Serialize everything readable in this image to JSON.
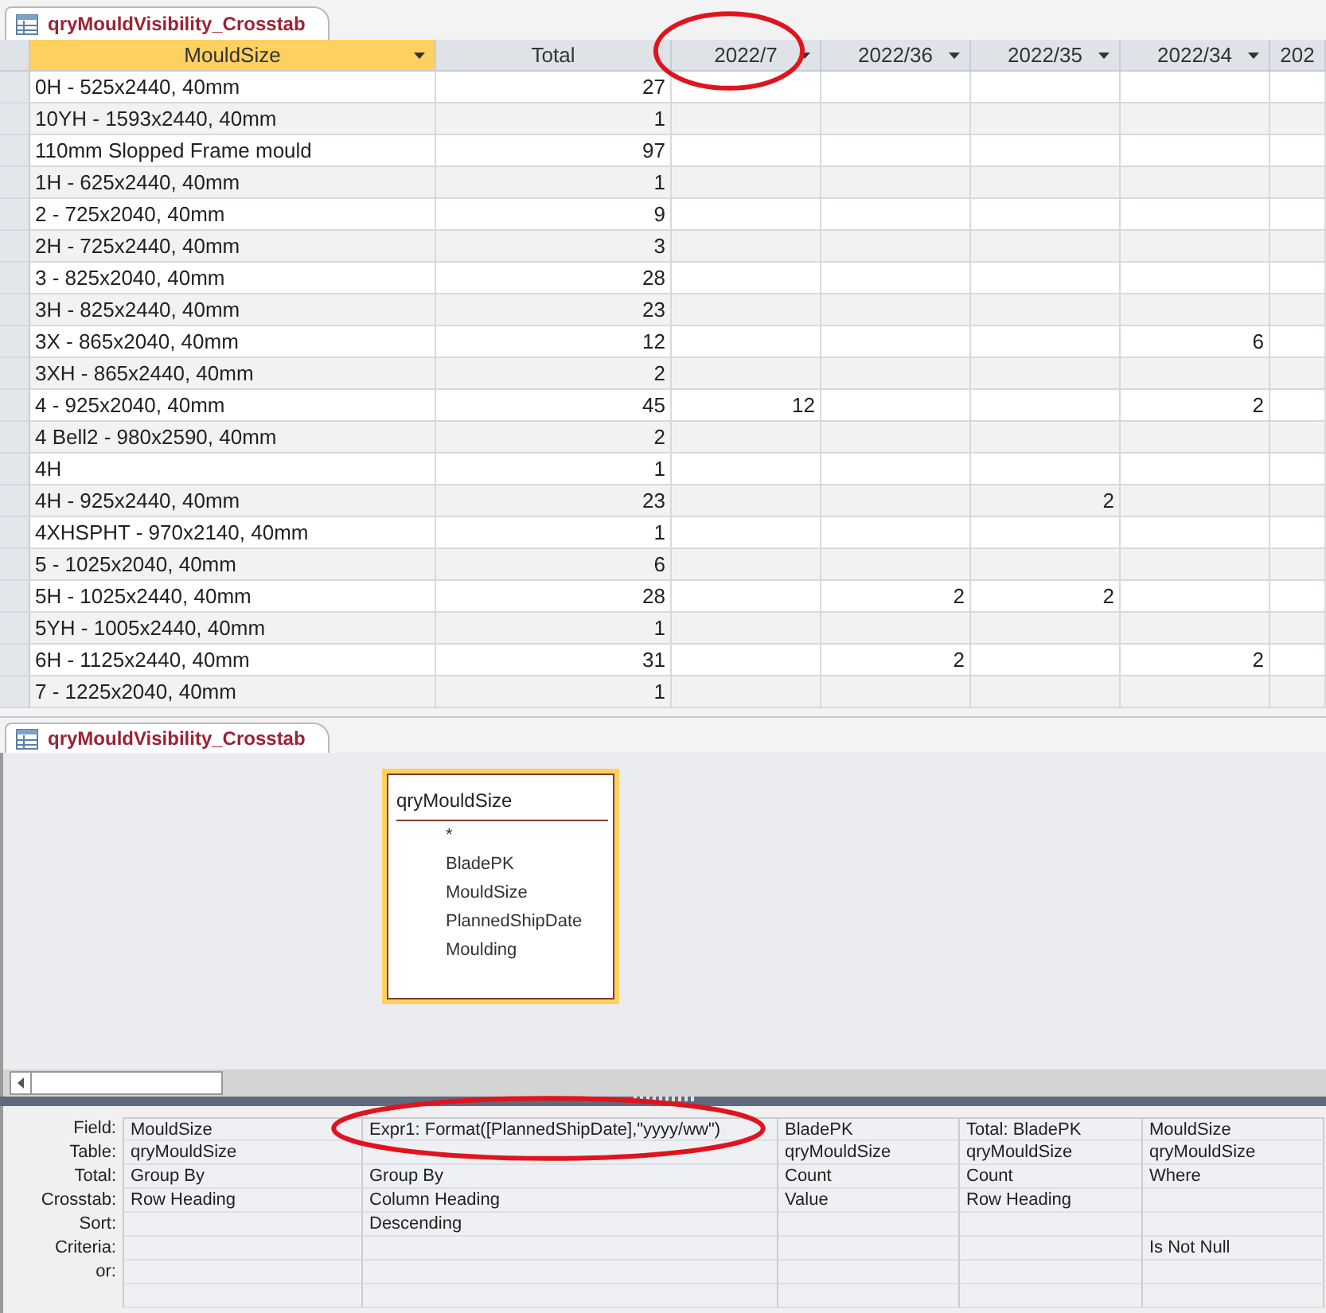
{
  "datasheet": {
    "tab": {
      "title": "qryMouldVisibility_Crosstab"
    },
    "columns": [
      {
        "label": "MouldSize",
        "selected": true,
        "dropdown": true,
        "circled": false
      },
      {
        "label": "Total",
        "selected": false,
        "dropdown": false,
        "circled": false
      },
      {
        "label": "2022/7",
        "selected": false,
        "dropdown": true,
        "circled": true
      },
      {
        "label": "2022/36",
        "selected": false,
        "dropdown": true,
        "circled": false
      },
      {
        "label": "2022/35",
        "selected": false,
        "dropdown": true,
        "circled": false
      },
      {
        "label": "2022/34",
        "selected": false,
        "dropdown": true,
        "circled": false
      },
      {
        "label": "202",
        "selected": false,
        "dropdown": false,
        "circled": false
      }
    ],
    "rows": [
      [
        "0H - 525x2440, 40mm",
        "27",
        null,
        null,
        null,
        null,
        null
      ],
      [
        "10YH - 1593x2440, 40mm",
        "1",
        null,
        null,
        null,
        null,
        null
      ],
      [
        "110mm Slopped Frame mould",
        "97",
        null,
        null,
        null,
        null,
        null
      ],
      [
        "1H - 625x2440, 40mm",
        "1",
        null,
        null,
        null,
        null,
        null
      ],
      [
        "2 - 725x2040, 40mm",
        "9",
        null,
        null,
        null,
        null,
        null
      ],
      [
        "2H - 725x2440, 40mm",
        "3",
        null,
        null,
        null,
        null,
        null
      ],
      [
        "3 - 825x2040, 40mm",
        "28",
        null,
        null,
        null,
        null,
        null
      ],
      [
        "3H - 825x2440, 40mm",
        "23",
        null,
        null,
        null,
        null,
        null
      ],
      [
        "3X - 865x2040, 40mm",
        "12",
        null,
        null,
        null,
        "6",
        null
      ],
      [
        "3XH - 865x2440, 40mm",
        "2",
        null,
        null,
        null,
        null,
        null
      ],
      [
        "4 - 925x2040, 40mm",
        "45",
        "12",
        null,
        null,
        "2",
        null
      ],
      [
        "4 Bell2 - 980x2590, 40mm",
        "2",
        null,
        null,
        null,
        null,
        null
      ],
      [
        "4H",
        "1",
        null,
        null,
        null,
        null,
        null
      ],
      [
        "4H - 925x2440, 40mm",
        "23",
        null,
        null,
        "2",
        null,
        null
      ],
      [
        "4XHSPHT - 970x2140, 40mm",
        "1",
        null,
        null,
        null,
        null,
        null
      ],
      [
        "5 - 1025x2040, 40mm",
        "6",
        null,
        null,
        null,
        null,
        null
      ],
      [
        "5H - 1025x2440, 40mm",
        "28",
        null,
        "2",
        "2",
        null,
        null
      ],
      [
        "5YH - 1005x2440, 40mm",
        "1",
        null,
        null,
        null,
        null,
        null
      ],
      [
        "6H - 1125x2440, 40mm",
        "31",
        null,
        "2",
        null,
        "2",
        null
      ],
      [
        "7 - 1225x2040, 40mm",
        "1",
        null,
        null,
        null,
        null,
        null
      ]
    ]
  },
  "design_view": {
    "tab": {
      "title": "qryMouldVisibility_Crosstab"
    },
    "table": {
      "title": "qryMouldSize",
      "fields": [
        "*",
        "BladePK",
        "MouldSize",
        "PlannedShipDate",
        "Moulding"
      ]
    },
    "grid": {
      "row_labels": [
        "Field:",
        "Table:",
        "Total:",
        "Crosstab:",
        "Sort:",
        "Criteria:",
        "or:"
      ],
      "columns": [
        {
          "circled": false,
          "cells": [
            "MouldSize",
            "qryMouldSize",
            "Group By",
            "Row Heading",
            null,
            null,
            null
          ]
        },
        {
          "circled": true,
          "cells": [
            "Expr1: Format([PlannedShipDate],\"yyyy/ww\")",
            null,
            "Group By",
            "Column Heading",
            "Descending",
            null,
            null
          ]
        },
        {
          "circled": false,
          "cells": [
            "BladePK",
            "qryMouldSize",
            "Count",
            "Value",
            null,
            null,
            null
          ]
        },
        {
          "circled": false,
          "cells": [
            "Total: BladePK",
            "qryMouldSize",
            "Count",
            "Row Heading",
            null,
            null,
            null
          ]
        },
        {
          "circled": false,
          "cells": [
            "MouldSize",
            "qryMouldSize",
            "Where",
            null,
            null,
            "Is Not Null",
            null
          ]
        }
      ]
    }
  }
}
